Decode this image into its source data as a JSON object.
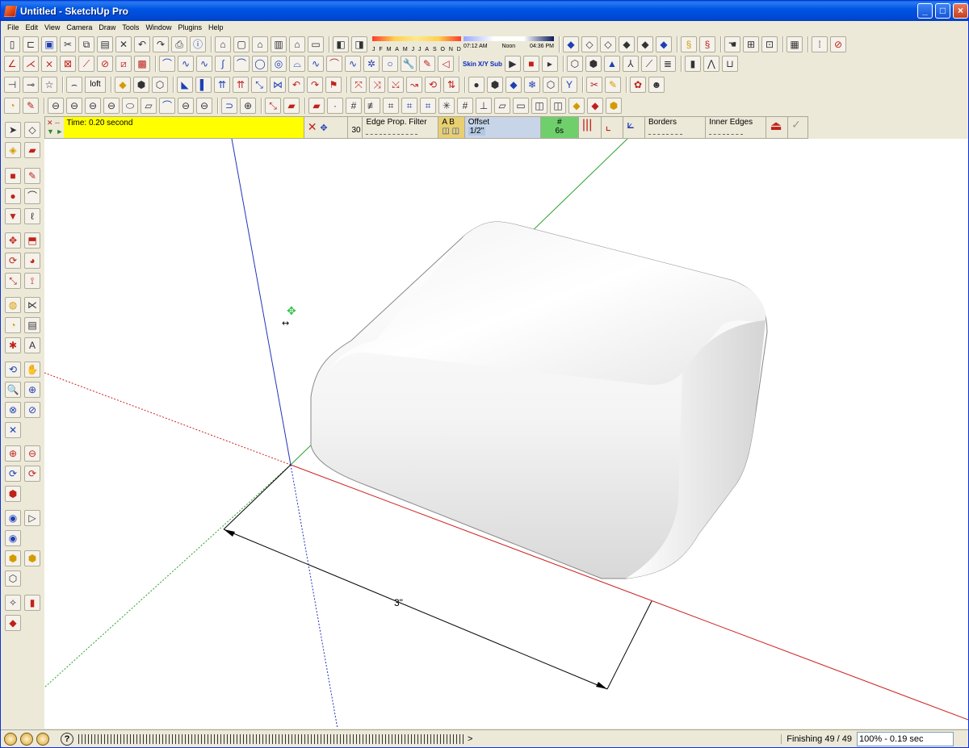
{
  "window": {
    "title": "Untitled - SketchUp Pro",
    "controls": {
      "minimize": "_",
      "maximize": "□",
      "close": "×"
    }
  },
  "menubar": {
    "items": [
      "File",
      "Edit",
      "View",
      "Camera",
      "Draw",
      "Tools",
      "Window",
      "Plugins",
      "Help"
    ]
  },
  "shadows": {
    "months": [
      "J",
      "F",
      "M",
      "A",
      "M",
      "J",
      "J",
      "A",
      "S",
      "O",
      "N",
      "D"
    ],
    "time_start": "07:12 AM",
    "time_noon": "Noon",
    "time_end": "04:36 PM"
  },
  "skin_toolbar": {
    "skin": "Skin",
    "xy": "X/Y",
    "sub": "Sub"
  },
  "loft_label": "loft",
  "roundcorner_panel": {
    "time": "Time: 0.20 second",
    "segments": "30",
    "edge_filter_label": "Edge Prop. Filter",
    "ab_label": "A B",
    "offset_label": "Offset",
    "offset_value": "1/2\"",
    "count_label": "#",
    "count_value": "6s",
    "borders_label": "Borders",
    "inner_edges_label": "Inner Edges"
  },
  "viewport": {
    "dimension_label": "3\"",
    "colors": {
      "red_axis": "#cc2222",
      "green_axis": "#2aa02a",
      "blue_axis": "#2233bb"
    }
  },
  "statusbar": {
    "finishing": "Finishing 49 / 49",
    "zoom": "100% - 0.19 sec"
  }
}
